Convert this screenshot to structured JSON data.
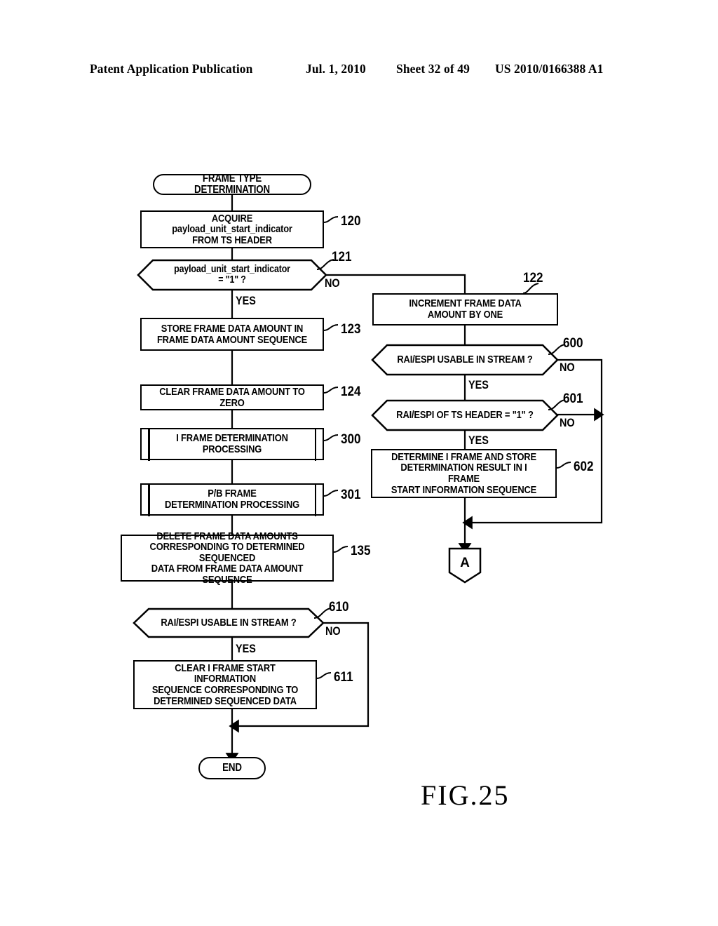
{
  "header": {
    "publication": "Patent Application Publication",
    "date": "Jul. 1, 2010",
    "sheet": "Sheet 32 of 49",
    "patent_number": "US 2010/0166388 A1"
  },
  "figure": {
    "caption": "FIG.25",
    "title": "FRAME TYPE DETERMINATION"
  },
  "nodes": {
    "start": {
      "label": "FRAME TYPE DETERMINATION",
      "ref": ""
    },
    "s120": {
      "label": "ACQUIRE payload_unit_start_indicator\nFROM TS HEADER",
      "ref": "120"
    },
    "s121": {
      "label": "payload_unit_start_indicator\n= \"1\" ?",
      "ref": "121"
    },
    "s123": {
      "label": "STORE FRAME DATA AMOUNT IN\nFRAME DATA AMOUNT SEQUENCE",
      "ref": "123"
    },
    "s124": {
      "label": "CLEAR FRAME DATA AMOUNT TO ZERO",
      "ref": "124"
    },
    "s300": {
      "label": "I FRAME DETERMINATION\nPROCESSING",
      "ref": "300"
    },
    "s301": {
      "label": "P/B FRAME\nDETERMINATION PROCESSING",
      "ref": "301"
    },
    "s135": {
      "label": "DELETE FRAME DATA AMOUNTS\nCORRESPONDING TO DETERMINED SEQUENCED\nDATA FROM FRAME DATA AMOUNT SEQUENCE",
      "ref": "135"
    },
    "s610": {
      "label": "RAI/ESPI USABLE IN STREAM ?",
      "ref": "610"
    },
    "s611": {
      "label": "CLEAR I FRAME START INFORMATION\nSEQUENCE CORRESPONDING TO\nDETERMINED SEQUENCED DATA",
      "ref": "611"
    },
    "end": {
      "label": "END",
      "ref": ""
    },
    "s122": {
      "label": "INCREMENT FRAME DATA\nAMOUNT BY ONE",
      "ref": "122"
    },
    "s600": {
      "label": "RAI/ESPI USABLE IN STREAM ?",
      "ref": "600"
    },
    "s601": {
      "label": "RAI/ESPI OF TS HEADER = \"1\" ?",
      "ref": "601"
    },
    "s602": {
      "label": "DETERMINE I FRAME AND STORE\nDETERMINATION RESULT IN I FRAME\nSTART INFORMATION SEQUENCE",
      "ref": "602"
    },
    "connA": {
      "label": "A",
      "ref": ""
    }
  },
  "branches": {
    "b121_yes": "YES",
    "b121_no": "NO",
    "b600_yes": "YES",
    "b600_no": "NO",
    "b601_yes": "YES",
    "b601_no": "NO",
    "b610_yes": "YES",
    "b610_no": "NO"
  },
  "colors": {
    "ink": "#000000",
    "paper": "#ffffff"
  }
}
